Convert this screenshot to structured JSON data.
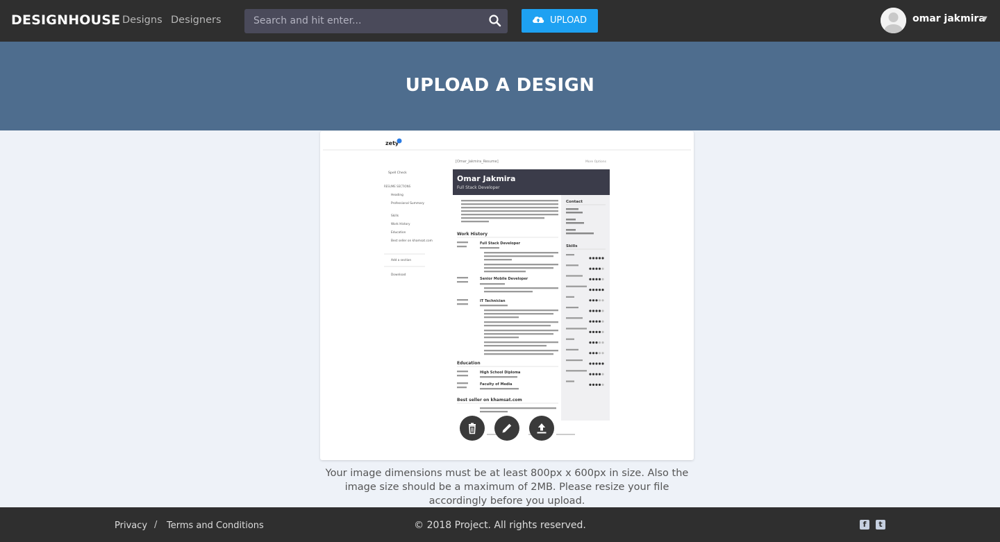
{
  "nav": {
    "brand": "DESIGNHOUSE",
    "links": [
      "Designs",
      "Designers"
    ],
    "search": {
      "placeholder": "Search and hit enter..."
    },
    "upload_label": "UPLOAD",
    "user_name": "omar jakmira"
  },
  "hero": {
    "title": "UPLOAD A DESIGN"
  },
  "preview": {
    "logo": "zety",
    "doc_title": "[Omar_Jakmira_Resume]",
    "more_options": "More Options",
    "sidebar": {
      "spell_check": "Spell Check",
      "sections_header": "RESUME SECTIONS",
      "items": [
        "Heading",
        "Professional Summary",
        "Skills",
        "Work History",
        "Education",
        "Best seller on khamsat.com"
      ],
      "add_section": "Add a section",
      "download": "Download"
    },
    "resume": {
      "name": "Omar Jakmira",
      "role": "Full Stack Developer",
      "sections": [
        "Work History",
        "Education",
        "Best seller on khamsat.com"
      ],
      "jobs": [
        "Full Stack Developer",
        "Senior Mobile Developer",
        "IT Technician"
      ],
      "education": [
        "High School Diploma",
        "Faculty of Media"
      ],
      "contact_header": "Contact",
      "skills_header": "Skills"
    }
  },
  "actions": {
    "delete": "delete-icon",
    "edit": "edit-icon",
    "upload": "upload-icon"
  },
  "note": "Your image dimensions must be at least 800px x 600px in size. Also the image size should be a maximum of 2MB. Please resize your file accordingly before you upload.",
  "footer": {
    "privacy": "Privacy",
    "separator": "/",
    "terms": "Terms and Conditions",
    "copyright": "© 2018 Project. All rights reserved.",
    "social": [
      "facebook-icon",
      "twitter-icon"
    ]
  },
  "colors": {
    "nav": "#2f2f2f",
    "hero": "#4e6d8e",
    "accent": "#1ea1f2",
    "page_bg": "#eef2f8"
  }
}
